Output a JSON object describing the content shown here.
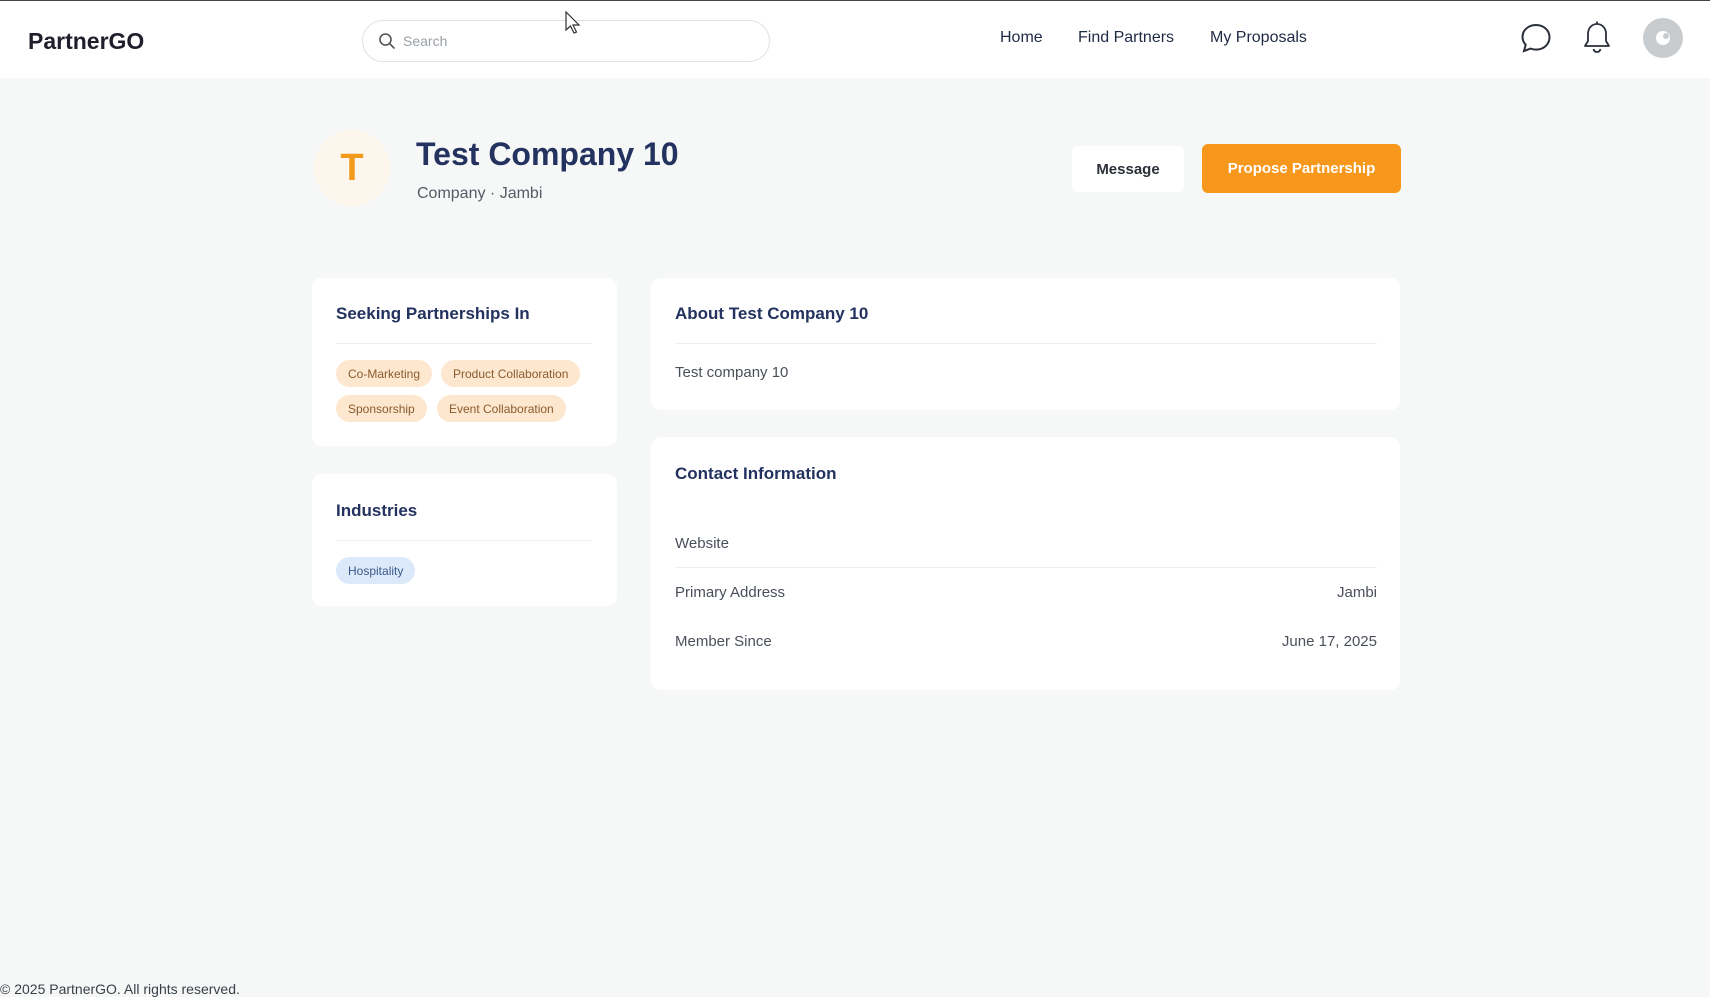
{
  "header": {
    "logo": "PartnerGO",
    "search_placeholder": "Search",
    "nav": [
      "Home",
      "Find Partners",
      "My Proposals"
    ]
  },
  "icons": {
    "search": "search-icon",
    "chat": "chat-bubble-icon",
    "bell": "bell-icon",
    "avatar": "user-avatar-icon"
  },
  "profile": {
    "initial": "T",
    "name": "Test Company 10",
    "subtitle": "Company · Jambi",
    "message_label": "Message",
    "propose_label": "Propose Partnership"
  },
  "seeking": {
    "title": "Seeking Partnerships In",
    "tags": [
      "Co-Marketing",
      "Product Collaboration",
      "Sponsorship",
      "Event Collaboration"
    ]
  },
  "industries": {
    "title": "Industries",
    "tags": [
      "Hospitality"
    ]
  },
  "about": {
    "title": "About Test Company 10",
    "text": "Test company 10"
  },
  "contact": {
    "title": "Contact Information",
    "rows": [
      {
        "label": "Website",
        "value": ""
      },
      {
        "label": "Primary Address",
        "value": "Jambi"
      },
      {
        "label": "Member Since",
        "value": "June 17, 2025"
      }
    ]
  },
  "footer": {
    "text": "© 2025 PartnerGO. All rights reserved."
  },
  "colors": {
    "accent": "#f7981d",
    "heading": "#23325f",
    "page_bg": "#f6f8f7"
  }
}
